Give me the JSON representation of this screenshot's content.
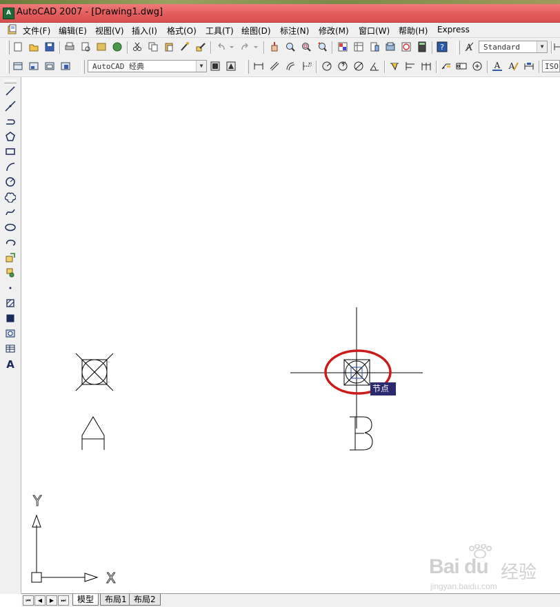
{
  "window": {
    "title": "AutoCAD 2007 - [Drawing1.dwg]",
    "app_icon_text": "A"
  },
  "menu": {
    "items": [
      "文件(F)",
      "编辑(E)",
      "视图(V)",
      "插入(I)",
      "格式(O)",
      "工具(T)",
      "绘图(D)",
      "标注(N)",
      "修改(M)",
      "窗口(W)",
      "帮助(H)",
      "Express"
    ]
  },
  "toolbar": {
    "text_style": "Standard",
    "workspace": "AutoCAD 经典",
    "dim_style": "ISO-"
  },
  "canvas": {
    "label_a": "A",
    "label_b": "B",
    "tooltip": "节点",
    "ucs_y": "Y",
    "ucs_x": "X"
  },
  "tabs": {
    "nav": [
      "⏮",
      "◀",
      "▶",
      "⏭"
    ],
    "items": [
      "模型",
      "布局1",
      "布局2"
    ],
    "active": "模型"
  },
  "watermark": {
    "logo": "Bai du",
    "brand": "经验",
    "url": "jingyan.baidu.com"
  },
  "colors": {
    "title_bar": "#e25a5a",
    "highlight_circle": "#cc1a1a",
    "tooltip_bg": "#2b2a6e"
  }
}
